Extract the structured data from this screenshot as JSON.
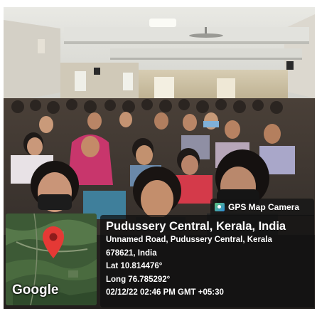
{
  "camera_badge": {
    "label": "GPS Map Camera",
    "icon": "gps-map-camera-icon"
  },
  "location": {
    "title": "Pudussery Central, Kerala, India",
    "address": "Unnamed Road, Pudussery Central, Kerala",
    "postal": "678621, India",
    "lat": "Lat 10.814476°",
    "long": "Long 76.785292°",
    "datetime": "02/12/22 02:46 PM GMT +05:30"
  },
  "map": {
    "brand": "Google",
    "pin_icon": "map-pin-icon",
    "pin_color": "#e53935"
  }
}
